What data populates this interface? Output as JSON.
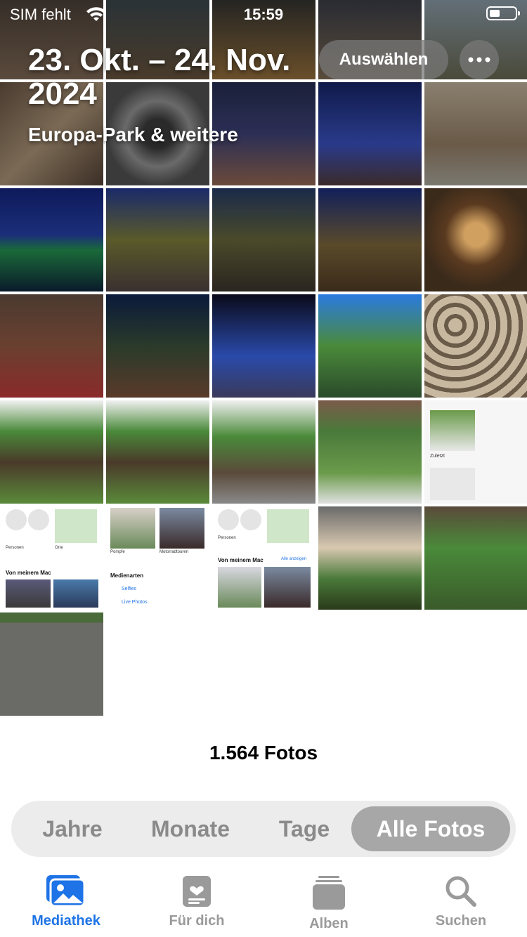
{
  "status": {
    "carrier": "SIM fehlt",
    "time": "15:59"
  },
  "header": {
    "title": "23. Okt. – 24. Nov. 2024",
    "subtitle": "Europa-Park & weitere",
    "select_label": "Auswählen",
    "more_icon": "ellipsis-icon"
  },
  "photos_count": "1.564 Fotos",
  "segments": [
    {
      "label": "Jahre"
    },
    {
      "label": "Monate"
    },
    {
      "label": "Tage"
    },
    {
      "label": "Alle Fotos"
    }
  ],
  "tabs": [
    {
      "label": "Mediathek",
      "icon": "photo-library-icon",
      "active": true
    },
    {
      "label": "Für dich",
      "icon": "for-you-icon",
      "active": false
    },
    {
      "label": "Alben",
      "icon": "albums-icon",
      "active": false
    },
    {
      "label": "Suchen",
      "icon": "search-icon",
      "active": false
    }
  ],
  "colors": {
    "accent": "#1e73e6",
    "segment_active": "#a7a7a7"
  },
  "thumb_text": {
    "widget_zuletzt": "Zuletzt",
    "widget_personen": "Personen",
    "widget_orte": "Orte",
    "widget_von_meinem_mac": "Von meinem Mac",
    "widget_alle_anzeigen": "Alle anzeigen",
    "widget_pompfe": "Pompfe",
    "widget_motorradtouren": "Motorradtouren",
    "widget_medienarten": "Medienarten",
    "widget_selfies": "Selfies",
    "widget_live_photos": "Live Photos"
  }
}
